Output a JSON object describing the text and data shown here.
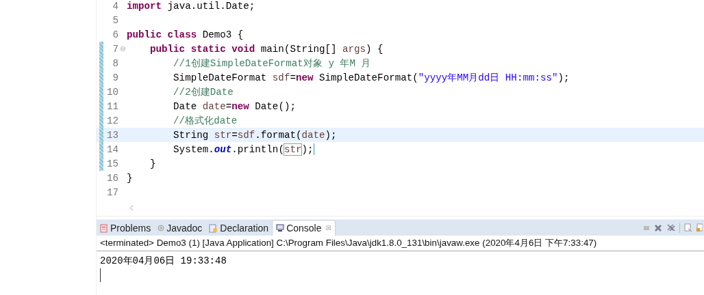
{
  "editor": {
    "lines": [
      {
        "number": "4",
        "tokens": [
          {
            "text": "import",
            "kind": "kw"
          },
          {
            "text": " java.util.Date;",
            "kind": "plain"
          }
        ]
      },
      {
        "number": "5"
      },
      {
        "number": "6",
        "tokens": [
          {
            "text": "public class",
            "kind": "kw"
          },
          {
            "text": " Demo3 {",
            "kind": "plain"
          }
        ]
      },
      {
        "number": "7",
        "fold": true,
        "changed": true,
        "tokens": [
          {
            "text": "    public static void",
            "kind": "kw"
          },
          {
            "text": " main(String[] ",
            "kind": "plain"
          },
          {
            "text": "args",
            "kind": "var"
          },
          {
            "text": ") {",
            "kind": "plain"
          }
        ]
      },
      {
        "number": "8",
        "changed": true,
        "tokens": [
          {
            "text": "        //1创建SimpleDateFormat对象 y 年M 月",
            "kind": "comment"
          }
        ]
      },
      {
        "number": "9",
        "changed": true,
        "tokens": [
          {
            "text": "        SimpleDateFormat ",
            "kind": "plain"
          },
          {
            "text": "sdf",
            "kind": "var"
          },
          {
            "text": "=",
            "kind": "plain"
          },
          {
            "text": "new",
            "kind": "kw"
          },
          {
            "text": " SimpleDateFormat(",
            "kind": "plain"
          },
          {
            "text": "\"yyyy年MM月dd日 HH:mm:ss\"",
            "kind": "str"
          },
          {
            "text": ");",
            "kind": "plain"
          }
        ]
      },
      {
        "number": "10",
        "changed": true,
        "tokens": [
          {
            "text": "        //2创建Date",
            "kind": "comment"
          }
        ]
      },
      {
        "number": "11",
        "changed": true,
        "tokens": [
          {
            "text": "        Date ",
            "kind": "plain"
          },
          {
            "text": "date",
            "kind": "var"
          },
          {
            "text": "=",
            "kind": "plain"
          },
          {
            "text": "new",
            "kind": "kw"
          },
          {
            "text": " Date();",
            "kind": "plain"
          }
        ]
      },
      {
        "number": "12",
        "changed": true,
        "tokens": [
          {
            "text": "        //格式化date",
            "kind": "comment"
          }
        ]
      },
      {
        "number": "13",
        "changed": true,
        "current": true,
        "tokens": [
          {
            "text": "        String ",
            "kind": "plain"
          },
          {
            "text": "str",
            "kind": "var"
          },
          {
            "text": "=",
            "kind": "plain"
          },
          {
            "text": "sdf",
            "kind": "var"
          },
          {
            "text": ".format(",
            "kind": "plain"
          },
          {
            "text": "date",
            "kind": "var"
          },
          {
            "text": ");",
            "kind": "plain"
          }
        ]
      },
      {
        "number": "14",
        "changed": true,
        "caret": true,
        "tokens": [
          {
            "text": "        System.",
            "kind": "plain"
          },
          {
            "text": "out",
            "kind": "field"
          },
          {
            "text": ".println(",
            "kind": "plain"
          },
          {
            "text": "str",
            "kind": "varbox"
          },
          {
            "text": ");",
            "kind": "plain"
          }
        ]
      },
      {
        "number": "15",
        "changed": true,
        "tokens": [
          {
            "text": "    }",
            "kind": "plain"
          }
        ]
      },
      {
        "number": "16",
        "tokens": [
          {
            "text": "}",
            "kind": "plain"
          }
        ]
      },
      {
        "number": "17"
      }
    ]
  },
  "tabs": [
    {
      "label": "Problems",
      "selected": false
    },
    {
      "label": "Javadoc",
      "selected": false
    },
    {
      "label": "Declaration",
      "selected": false
    },
    {
      "label": "Console",
      "selected": true,
      "close": "☒"
    }
  ],
  "console": {
    "header": "<terminated> Demo3 (1) [Java Application] C:\\Program Files\\Java\\jdk1.8.0_131\\bin\\javaw.exe (2020年4月6日 下午7:33:47)",
    "output": "2020年04月06日 19:33:48"
  }
}
